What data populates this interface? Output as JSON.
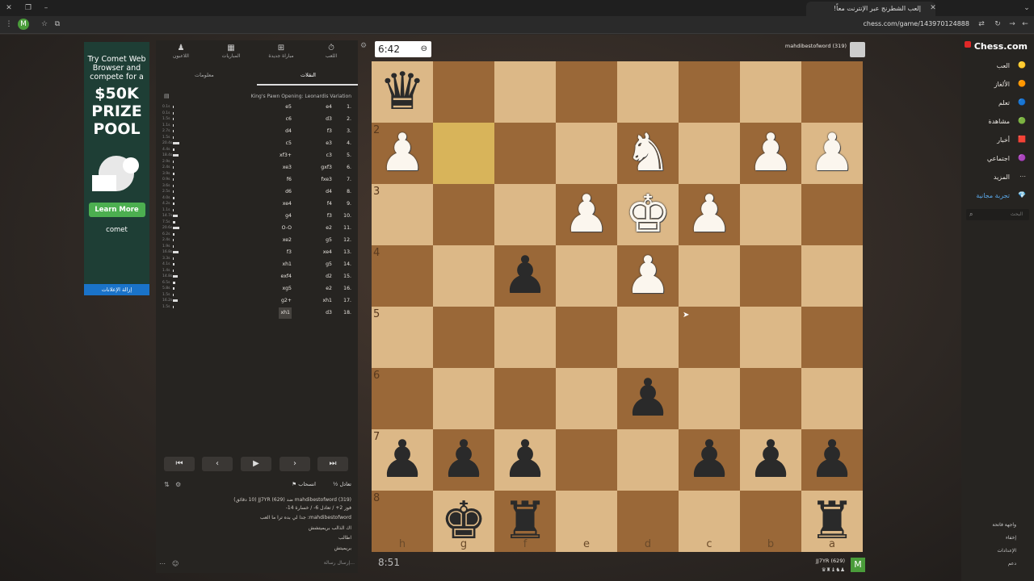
{
  "browser": {
    "tab_title": "إلعب الشطرنج عبر الإنترنت معاً!",
    "url": "chess.com/game/143970124888"
  },
  "ad": {
    "line1": "Try Comet Web Browser and compete for a",
    "line2": "$50K PRIZE POOL",
    "learn": "Learn More",
    "brand": "comet",
    "remove": "إزالة الإعلانات"
  },
  "panel": {
    "nav": [
      "اللعب",
      "مباراة جديدة",
      "المباريات",
      "اللاعبون"
    ],
    "subtabs": {
      "moves": "النقلات",
      "info": "معلومات"
    },
    "opening": "King's Pawn Opening: Leonardis Variation",
    "moves": [
      {
        "n": "1.",
        "w": "e4",
        "b": "e5"
      },
      {
        "n": "2.",
        "w": "d3",
        "b": "c6"
      },
      {
        "n": "3.",
        "w": "f3",
        "b": "d4"
      },
      {
        "n": "4.",
        "w": "e3",
        "b": "c5"
      },
      {
        "n": "5.",
        "w": "c3",
        "b": "xf3+"
      },
      {
        "n": "6.",
        "w": "gxf3",
        "b": "xe3"
      },
      {
        "n": "7.",
        "w": "fxe3",
        "b": "f6"
      },
      {
        "n": "8.",
        "w": "d4",
        "b": "d6"
      },
      {
        "n": "9.",
        "w": "f4",
        "b": "xe4"
      },
      {
        "n": "10.",
        "w": "f3",
        "b": "g4"
      },
      {
        "n": "11.",
        "w": "e2",
        "b": "O-O"
      },
      {
        "n": "12.",
        "w": "g5",
        "b": "xe2"
      },
      {
        "n": "13.",
        "w": "xe4",
        "b": "f3"
      },
      {
        "n": "14.",
        "w": "g5",
        "b": "xh1"
      },
      {
        "n": "15.",
        "w": "d2",
        "b": "exf4"
      },
      {
        "n": "16.",
        "w": "e2",
        "b": "xg5"
      },
      {
        "n": "17.",
        "w": "xh1",
        "b": "g2+"
      },
      {
        "n": "18.",
        "w": "d3",
        "b": "xh1"
      }
    ],
    "times": [
      "0.1s",
      "0.1s",
      "1.5s",
      "1.1s",
      "2.7s",
      "1.5s",
      "20.4s",
      "4.4s",
      "18.4s",
      "2.9s",
      "2.4s",
      "3.9s",
      "0.9s",
      "3.6s",
      "2.5s",
      "4.0s",
      "4.2s",
      "1.1s",
      "14.7s",
      "7.5s",
      "20.6s",
      "6.2s",
      "2.4s",
      "1.9s",
      "16.8s",
      "3.3s",
      "4.1s",
      "1.4s",
      "14.8s",
      "6.5s",
      "5.8s",
      "1.5s",
      "16.2s",
      "1.5s"
    ],
    "chat": {
      "draw": "تعادل",
      "resign": "انسحاب",
      "l1": "mahdibestofword (319) ضد JJ7YR (629) (10 دقائق)",
      "l2": "فوز 2+ / تعادل 6- / خسارة 14-",
      "l3": "mahdibestofword: جدا لي بده ترا ما العب",
      "l4": "اك الذالب بريميتشش",
      "l5": "اطالب",
      "l6": "بريميتش",
      "placeholder": "إرسال رسالة..."
    }
  },
  "game": {
    "clock_top": "6:42",
    "clock_bottom": "8:51",
    "player_top": "mahdibestofword (319)",
    "player_bottom": "JJ7YR (629)",
    "avatar_bottom": "M",
    "ranks": [
      "2",
      "3",
      "4",
      "5",
      "6",
      "7",
      "8"
    ],
    "files": [
      "h",
      "g",
      "f",
      "e",
      "d",
      "c",
      "b",
      "a"
    ],
    "board": [
      [
        "bQ",
        "",
        "",
        "",
        "",
        "",
        "",
        ""
      ],
      [
        "wP",
        "hl",
        "",
        "",
        "wN",
        "",
        "wP",
        "wP"
      ],
      [
        "",
        "",
        "",
        "wP",
        "wK",
        "wP",
        "",
        ""
      ],
      [
        "",
        "",
        "bP",
        "",
        "wP",
        "",
        "",
        ""
      ],
      [
        "",
        "",
        "",
        "",
        "",
        "",
        "",
        ""
      ],
      [
        "",
        "",
        "",
        "",
        "bP",
        "",
        "",
        ""
      ],
      [
        "bP",
        "bP",
        "bP",
        "",
        "",
        "bP",
        "bP",
        "bP"
      ],
      [
        "",
        "bK",
        "bR",
        "",
        "",
        "",
        "",
        "bR"
      ]
    ]
  },
  "rightnav": {
    "logo": "Chess.com",
    "items": [
      "العب",
      "الألغاز",
      "تعلم",
      "مشاهدة",
      "أخبار",
      "اجتماعي",
      "المزيد",
      "تجربة مجانية"
    ],
    "search": "البحث",
    "bottom": [
      "واجهة فاتحة",
      "إخفاء",
      "الإعدادات",
      "دعم"
    ]
  }
}
